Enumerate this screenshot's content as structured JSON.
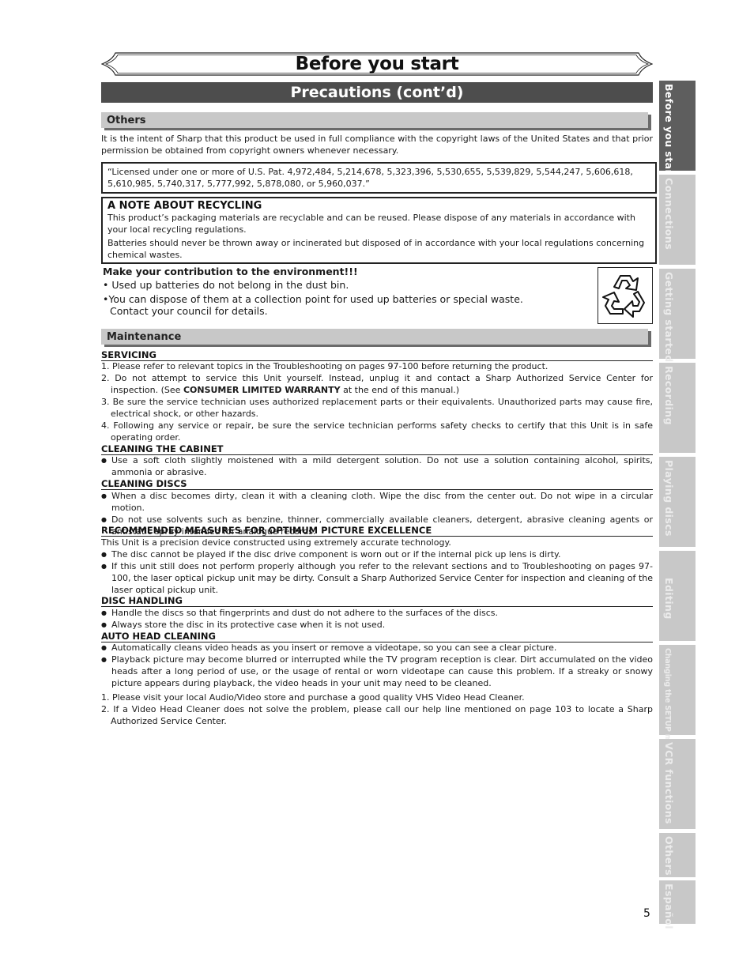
{
  "header": {
    "title": "Before you start",
    "section": "Precautions (cont’d)"
  },
  "others": {
    "heading": "Others",
    "intro": "It is the intent of Sharp that this product be used in full compliance with the copyright laws of the United States and that prior permission be obtained from copyright owners whenever necessary.",
    "patent_notice": "“Licensed under one or more of U.S. Pat. 4,972,484, 5,214,678, 5,323,396, 5,530,655, 5,539,829, 5,544,247, 5,606,618, 5,610,985, 5,740,317, 5,777,992, 5,878,080, or 5,960,037.”",
    "recycling": {
      "title": "A NOTE ABOUT RECYCLING",
      "paragraphs": [
        "This product’s packaging materials are recyclable and can be reused. Please dispose of any materials in accordance with your local recycling regulations.",
        "Batteries should never be thrown away or incinerated but disposed of in accordance with your local regulations concerning chemical wastes."
      ]
    },
    "environment": {
      "title": "Make your contribution to the environment!!!",
      "bullets": [
        "Used up batteries do not belong in the dust bin.",
        "You can dispose of them at a collection point for used up batteries or special waste.",
        "Contact your council for details."
      ],
      "icon": "recycle-icon"
    }
  },
  "maintenance": {
    "heading": "Maintenance",
    "servicing": {
      "heading": "SERVICING",
      "items": [
        "1. Please refer to relevant topics in the Troubleshooting on pages 97-100 before returning the product.",
        "2. Do not attempt to service this Unit yourself. Instead, unplug it and contact a Sharp Authorized Service Center for inspection. (See ",
        "3. Be sure the service technician uses authorized replacement parts or their equivalents. Unauthorized parts may cause fire, electrical shock, or other hazards.",
        "4. Following any service or repair, be sure the service technician performs safety checks to certify that this Unit is in safe operating order."
      ],
      "warranty_bold": "CONSUMER LIMITED WARRANTY",
      "warranty_tail": " at the end of this manual.)"
    },
    "cabinet": {
      "heading": "CLEANING THE CABINET",
      "bullets": [
        "Use a soft cloth slightly moistened with a mild detergent solution. Do not use a solution containing alcohol, spirits, ammonia or abrasive."
      ]
    },
    "discs": {
      "heading": "CLEANING DISCS",
      "bullets": [
        "When a disc becomes dirty, clean it with a cleaning cloth. Wipe the disc from the center out. Do not wipe in a circular motion.",
        "Do not use solvents such as benzine, thinner, commercially available cleaners, detergent, abrasive cleaning agents or antistatic spray intended for analogue records."
      ]
    },
    "picture": {
      "heading": "RECOMMENDED MEASURES FOR OPTIMUM PICTURE EXCELLENCE",
      "intro": "This Unit is a precision device constructed using extremely accurate technology.",
      "bullets": [
        "The disc cannot be played if the disc drive component is worn out or if the internal pick up lens is dirty.",
        "If this unit still does not perform properly although you refer to the relevant sections and to Troubleshooting  on pages 97-100, the laser optical pickup unit may be dirty. Consult a Sharp Authorized Service Center for inspection and cleaning of the laser optical pickup unit."
      ]
    },
    "handling": {
      "heading": "DISC HANDLING",
      "bullets": [
        "Handle the discs so that fingerprints and dust do not adhere to the surfaces of the discs.",
        "Always store the disc in its protective case when it is not used."
      ]
    },
    "head_cleaning": {
      "heading": "AUTO HEAD CLEANING",
      "bullets": [
        "Automatically cleans video heads as you insert or remove a videotape, so you can see a clear picture.",
        "Playback picture may become blurred or interrupted while the TV program reception is clear. Dirt accumulated on the video heads after a long period of use, or the usage of rental or worn videotape can cause this problem. If a streaky or snowy picture appears during playback, the video heads in your unit may need to be cleaned."
      ],
      "steps": [
        "1. Please visit your local Audio/Video store and purchase a good quality VHS Video Head Cleaner.",
        "2. If a Video Head Cleaner does not solve the problem, please call our help line mentioned on page 103 to locate a Sharp Authorized Service Center."
      ]
    }
  },
  "side_tabs": [
    {
      "label": "Before you start",
      "active": true
    },
    {
      "label": "Connections",
      "active": false
    },
    {
      "label": "Getting started",
      "active": false
    },
    {
      "label": "Recording",
      "active": false
    },
    {
      "label": "Playing discs",
      "active": false
    },
    {
      "label": "Editing",
      "active": false
    },
    {
      "label": "Changing the SETUP menu",
      "active": false
    },
    {
      "label": "VCR functions",
      "active": false
    },
    {
      "label": "Others",
      "active": false
    },
    {
      "label": "Español",
      "active": false
    }
  ],
  "footer": {
    "page_number": "5"
  }
}
